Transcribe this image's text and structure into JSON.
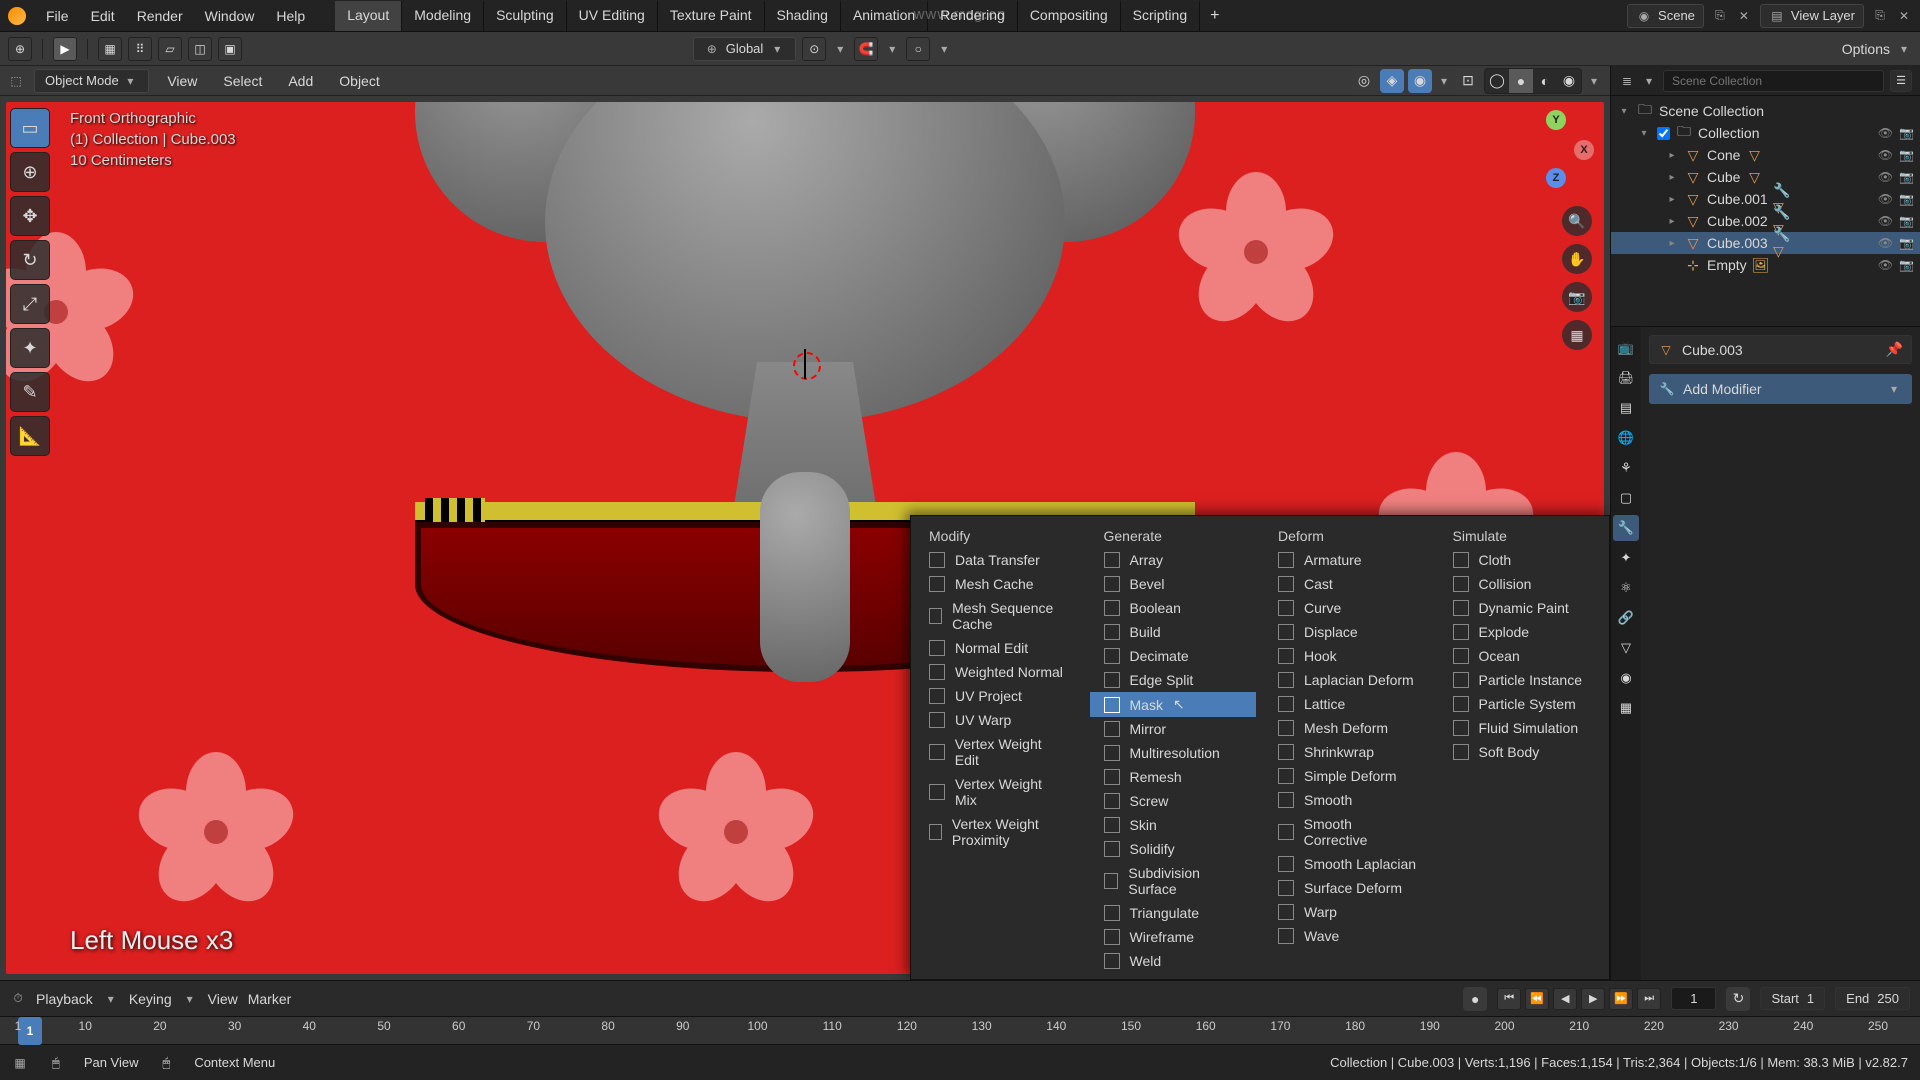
{
  "top_menu": [
    "File",
    "Edit",
    "Render",
    "Window",
    "Help"
  ],
  "workspaces": [
    "Layout",
    "Modeling",
    "Sculpting",
    "UV Editing",
    "Texture Paint",
    "Shading",
    "Animation",
    "Rendering",
    "Compositing",
    "Scripting"
  ],
  "active_workspace": "Layout",
  "scene_selector": {
    "label": "Scene"
  },
  "viewlayer_selector": {
    "label": "View Layer"
  },
  "transform_orientation": "Global",
  "watermark": "www.rrcg.cn",
  "header3d": {
    "mode": "Object Mode",
    "menus": [
      "View",
      "Select",
      "Add",
      "Object"
    ]
  },
  "viewport_overlay": {
    "line1": "Front Orthographic",
    "line2": "(1) Collection | Cube.003",
    "line3": "10 Centimeters"
  },
  "left_tools": [
    "select-box",
    "cursor",
    "move",
    "rotate",
    "scale",
    "transform",
    "annotate",
    "measure"
  ],
  "gizmo": {
    "x": "X",
    "y": "Y",
    "z": "Z"
  },
  "status_overlay": "Left Mouse x3",
  "toolbar2": {
    "options": "Options"
  },
  "modifier_menu": {
    "columns": [
      {
        "title": "Modify",
        "items": [
          "Data Transfer",
          "Mesh Cache",
          "Mesh Sequence Cache",
          "Normal Edit",
          "Weighted Normal",
          "UV Project",
          "UV Warp",
          "Vertex Weight Edit",
          "Vertex Weight Mix",
          "Vertex Weight Proximity"
        ]
      },
      {
        "title": "Generate",
        "items": [
          "Array",
          "Bevel",
          "Boolean",
          "Build",
          "Decimate",
          "Edge Split",
          "Mask",
          "Mirror",
          "Multiresolution",
          "Remesh",
          "Screw",
          "Skin",
          "Solidify",
          "Subdivision Surface",
          "Triangulate",
          "Wireframe",
          "Weld"
        ]
      },
      {
        "title": "Deform",
        "items": [
          "Armature",
          "Cast",
          "Curve",
          "Displace",
          "Hook",
          "Laplacian Deform",
          "Lattice",
          "Mesh Deform",
          "Shrinkwrap",
          "Simple Deform",
          "Smooth",
          "Smooth Corrective",
          "Smooth Laplacian",
          "Surface Deform",
          "Warp",
          "Wave"
        ]
      },
      {
        "title": "Simulate",
        "items": [
          "Cloth",
          "Collision",
          "Dynamic Paint",
          "Explode",
          "Ocean",
          "Particle Instance",
          "Particle System",
          "Fluid Simulation",
          "Soft Body"
        ]
      }
    ],
    "highlighted": "Mask",
    "cursor_label": "Mask"
  },
  "outliner": {
    "root": "Scene Collection",
    "collection": "Collection",
    "items": [
      {
        "name": "Cone",
        "icon": "tri"
      },
      {
        "name": "Cube",
        "icon": "tri"
      },
      {
        "name": "Cube.001",
        "icon": "tri"
      },
      {
        "name": "Cube.002",
        "icon": "tri"
      },
      {
        "name": "Cube.003",
        "icon": "tri",
        "selected": true
      },
      {
        "name": "Empty",
        "icon": "empty"
      }
    ]
  },
  "properties": {
    "object_name": "Cube.003",
    "add_modifier": "Add Modifier"
  },
  "timeline": {
    "menus": [
      "Playback",
      "Keying",
      "View",
      "Marker"
    ],
    "current": 1,
    "start_label": "Start",
    "start": 1,
    "end_label": "End",
    "end": 250,
    "ticks": [
      1,
      10,
      20,
      30,
      40,
      50,
      60,
      70,
      80,
      90,
      100,
      110,
      120,
      130,
      140,
      150,
      160,
      170,
      180,
      190,
      200,
      210,
      220,
      230,
      240,
      250
    ]
  },
  "statusbar": {
    "left1": "▦",
    "hint1": "Pan View",
    "hint2": "Context Menu",
    "right": "Collection | Cube.003 | Verts:1,196 | Faces:1,154 | Tris:2,364 | Objects:1/6 | Mem: 38.3 MiB | v2.82.7"
  }
}
